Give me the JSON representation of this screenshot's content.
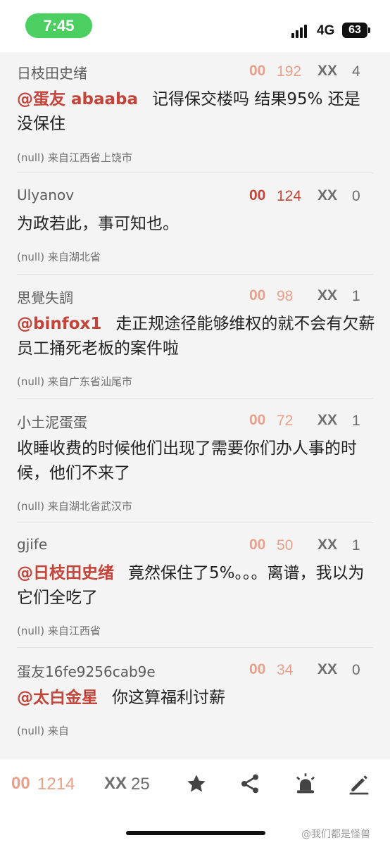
{
  "status_bar": {
    "time": "7:45",
    "network": "4G",
    "battery": "63"
  },
  "comments": [
    {
      "user": "日枝田史绪",
      "likes": "192",
      "dislikes": "4",
      "mention": "@蛋友 abaaba",
      "text": "记得保交楼吗 结果95% 还是没保住",
      "meta": "(null) 来自江西省上饶市"
    },
    {
      "user": "Ulyanov",
      "likes": "124",
      "dislikes": "0",
      "mention": "",
      "text": "为政若此，事可知也。",
      "meta": "(null) 来自湖北省"
    },
    {
      "user": "思覺失調",
      "likes": "98",
      "dislikes": "1",
      "mention": "@binfox1",
      "text": "走正规途径能够维权的就不会有欠薪员工捅死老板的案件啦",
      "meta": "(null) 来自广东省汕尾市"
    },
    {
      "user": "小土泥蛋蛋",
      "likes": "72",
      "dislikes": "1",
      "mention": "",
      "text": "收睡收费的时候他们出现了需要你们办人事的时候，他们不来了",
      "meta": "(null) 来自湖北省武汉市"
    },
    {
      "user": "gjife",
      "likes": "50",
      "dislikes": "1",
      "mention": "@日枝田史绪",
      "text": "竟然保住了5%。。。离谱，我以为它们全吃了",
      "meta": "(null) 来自江西省"
    },
    {
      "user": "蛋友16fe9256cab9e",
      "likes": "34",
      "dislikes": "0",
      "mention": "@太白金星",
      "text": "你这算福利讨薪",
      "meta": "(null) 来自"
    }
  ],
  "stat_icons": {
    "like": "00",
    "dislike": "XX"
  },
  "bottom_bar": {
    "like_icon": "00",
    "likes": "1214",
    "dislike_icon": "XX",
    "dislikes": "25"
  },
  "icons": [
    "star-icon",
    "share-icon",
    "alarm-icon",
    "edit-icon"
  ],
  "watermark": "@我们都是怪兽",
  "colors": {
    "accent_red": "#c4443a",
    "like_light": "#e8a08a",
    "status_green": "#4ccf61"
  }
}
